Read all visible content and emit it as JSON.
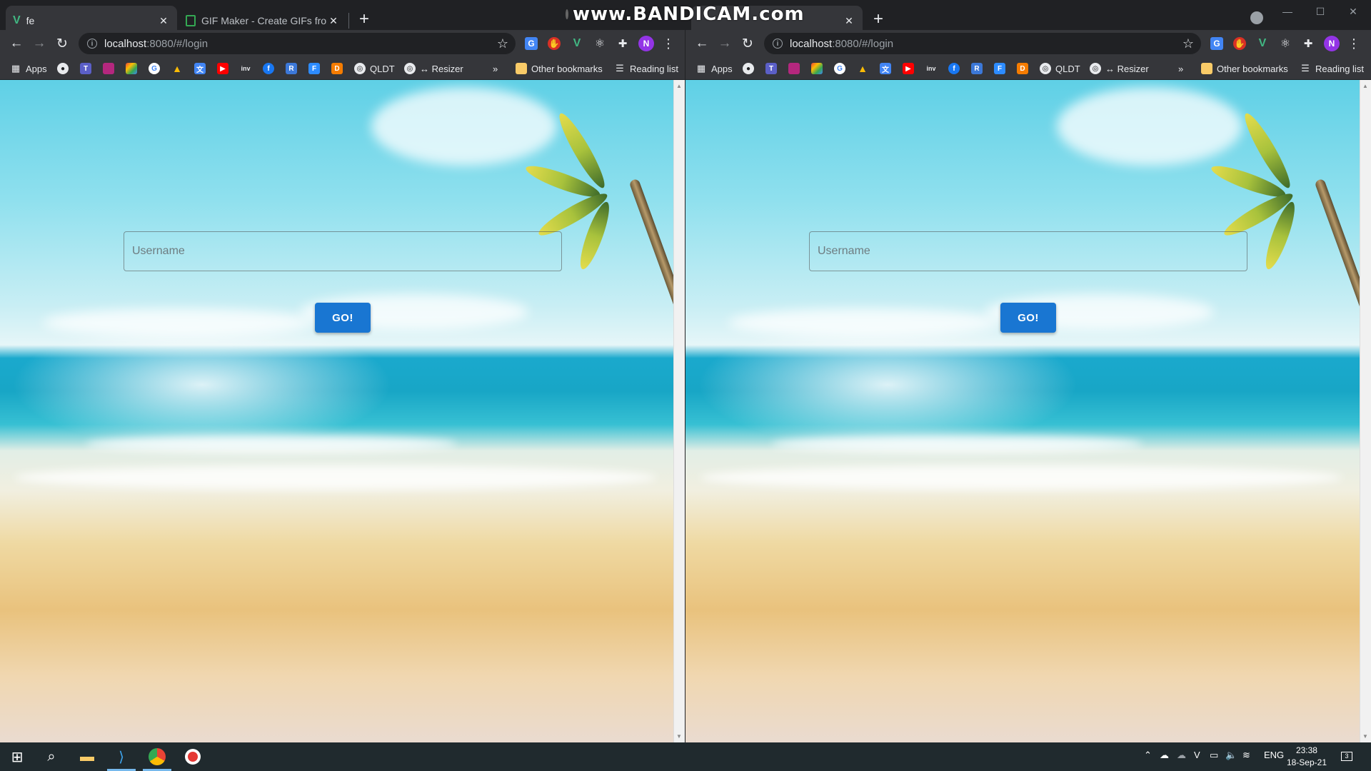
{
  "watermark": {
    "text": "www.BANDICAM.com"
  },
  "windows": [
    {
      "tabs": [
        {
          "icon": "vue-logo-icon",
          "title": "fe",
          "active": true
        },
        {
          "icon": "gifmaker-icon",
          "title": "GIF Maker - Create GIFs from Vid",
          "active": false
        }
      ],
      "url_host": "localhost",
      "url_rest": ":8080/#/login"
    },
    {
      "tabs": [
        {
          "icon": "vue-logo-icon",
          "title": "",
          "active": true
        }
      ],
      "url_host": "localhost",
      "url_rest": ":8080/#/login"
    }
  ],
  "bookmarks": {
    "apps": "Apps",
    "qldt": "QLDT",
    "resizer": "↔ Resizer",
    "more": "»",
    "other": "Other bookmarks",
    "reading": "Reading list"
  },
  "profile_initial": "N",
  "login": {
    "username_placeholder": "Username",
    "go_label": "GO!"
  },
  "taskbar": {
    "lang": "ENG",
    "time": "23:38",
    "date": "18-Sep-21",
    "notifications": "3"
  },
  "colors": {
    "accent": "#1976d2",
    "chrome_dark": "#202124",
    "chrome_toolbar": "#35363a",
    "avatar": "#9334e6"
  }
}
